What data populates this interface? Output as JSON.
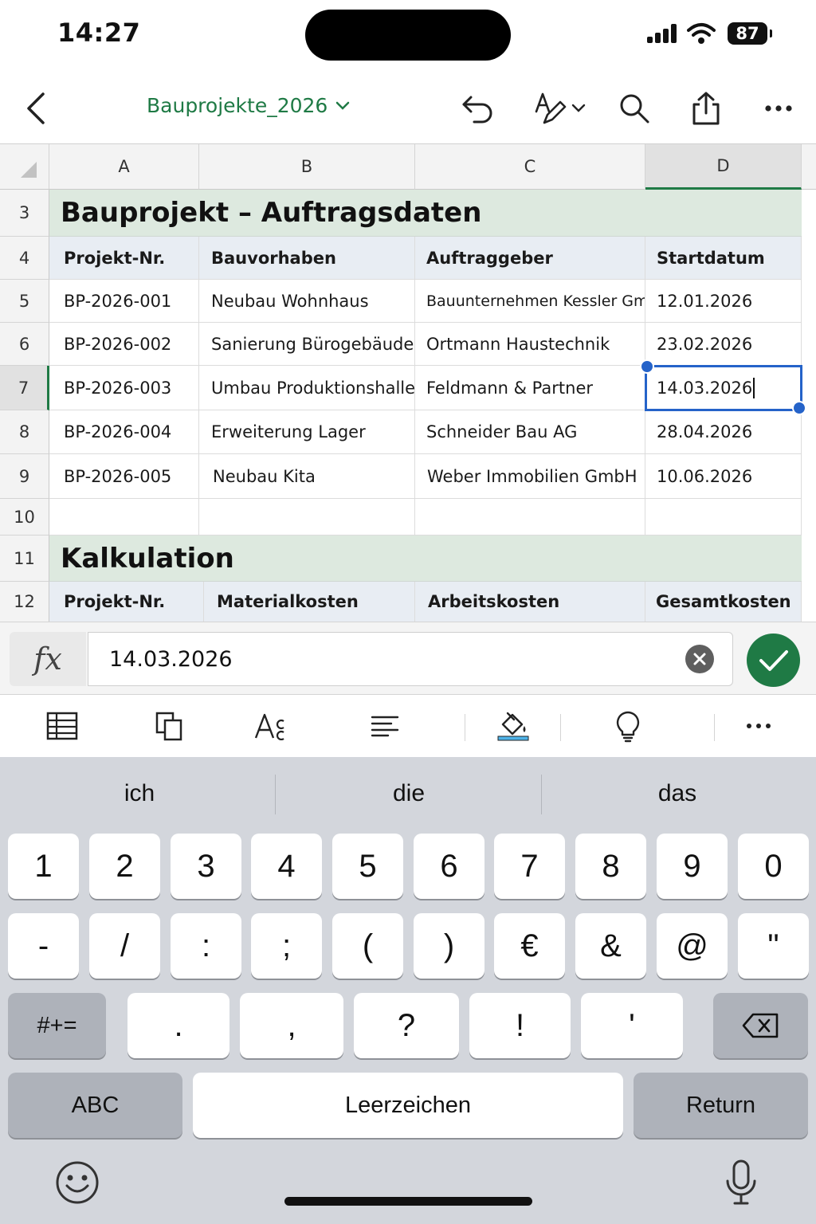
{
  "status_bar": {
    "time": "14:27",
    "battery": "87"
  },
  "toolbar": {
    "file_name": "Bauprojekte_2026"
  },
  "columns": [
    "A",
    "B",
    "C",
    "D"
  ],
  "rows": {
    "r3": "3",
    "r4": "4",
    "r5": "5",
    "r6": "6",
    "r7": "7",
    "r8": "8",
    "r9": "9",
    "r10": "10",
    "r11": "11",
    "r12": "12"
  },
  "section1": {
    "title": "Bauprojekt – Auftragsdaten",
    "headers": [
      "Projekt-Nr.",
      "Bauvorhaben",
      "Auftraggeber",
      "Startdatum"
    ],
    "rows": [
      [
        "BP-2026-001",
        "Neubau Wohnhaus",
        "Bauunternehmen Kessler GmbH",
        "12.01.2026"
      ],
      [
        "BP-2026-002",
        "Sanierung Bürogebäude",
        "Ortmann Haustechnik",
        "23.02.2026"
      ],
      [
        "BP-2026-003",
        "Umbau Produktionshalle",
        "Feldmann & Partner",
        "14.03.2026"
      ],
      [
        "BP-2026-004",
        "Erweiterung Lager",
        "Schneider Bau AG",
        "28.04.2026"
      ],
      [
        "BP-2026-005",
        "Neubau Kita",
        "Weber Immobilien GmbH",
        "10.06.2026"
      ]
    ]
  },
  "section2": {
    "title": "Kalkulation",
    "headers": [
      "Projekt-Nr.",
      "Materialkosten",
      "Arbeitskosten",
      "Gesamtkosten"
    ]
  },
  "formula_bar": {
    "fx_label": "fx",
    "value": "14.03.2026"
  },
  "keyboard": {
    "suggestions": [
      "ich",
      "die",
      "das"
    ],
    "row1": [
      "1",
      "2",
      "3",
      "4",
      "5",
      "6",
      "7",
      "8",
      "9",
      "0"
    ],
    "row2": [
      "-",
      "/",
      ":",
      ";",
      "(",
      ")",
      "€",
      "&",
      "@",
      "\""
    ],
    "row3_mode": "#+=",
    "row3": [
      ".",
      ",",
      "?",
      "!",
      "'"
    ],
    "abc": "ABC",
    "space": "Leerzeichen",
    "return": "Return"
  },
  "colors": {
    "accent": "#1f7a45",
    "selection": "#2563c9",
    "section_fill": "#dde9df",
    "header_fill": "#e8edf3"
  }
}
